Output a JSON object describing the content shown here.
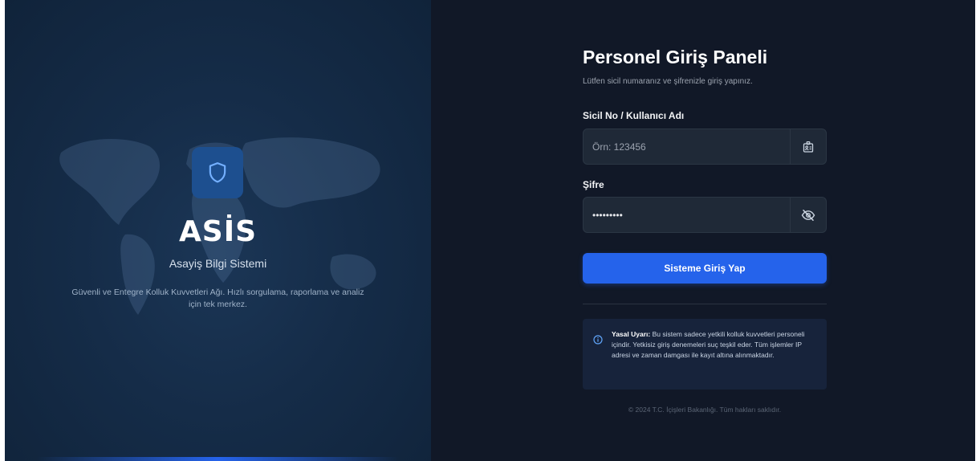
{
  "brand": {
    "name": "ASİS",
    "subtitle": "Asayiş Bilgi Sistemi",
    "description": "Güvenli ve Entegre Kolluk Kuvvetleri Ağı. Hızlı sorgulama, raporlama ve analiz için tek merkez."
  },
  "login": {
    "title": "Personel Giriş Paneli",
    "lead": "Lütfen sicil numaranız ve şifrenizle giriş yapınız.",
    "username_label": "Sicil No / Kullanıcı Adı",
    "username_placeholder": "Örn: 123456",
    "username_value": "",
    "password_label": "Şifre",
    "password_value": "password1",
    "submit_label": "Sisteme Giriş Yap"
  },
  "notice": {
    "heading": "Yasal Uyarı:",
    "text": " Bu sistem sadece yetkili kolluk kuvvetleri personeli içindir. Yetkisiz giriş denemeleri suç teşkil eder. Tüm işlemler IP adresi ve zaman damgası ile kayıt altına alınmaktadır."
  },
  "footer": "© 2024 T.C. İçişleri Bakanlığı. Tüm hakları saklıdır.",
  "icons": {
    "shield": "shield-icon",
    "id_card": "id-card-icon",
    "eye_off": "eye-off-icon",
    "info": "info-icon"
  },
  "colors": {
    "accent": "#2563eb",
    "left_panel": "#152c48",
    "right_panel": "#111827",
    "shield_box": "#1d4f8f"
  }
}
